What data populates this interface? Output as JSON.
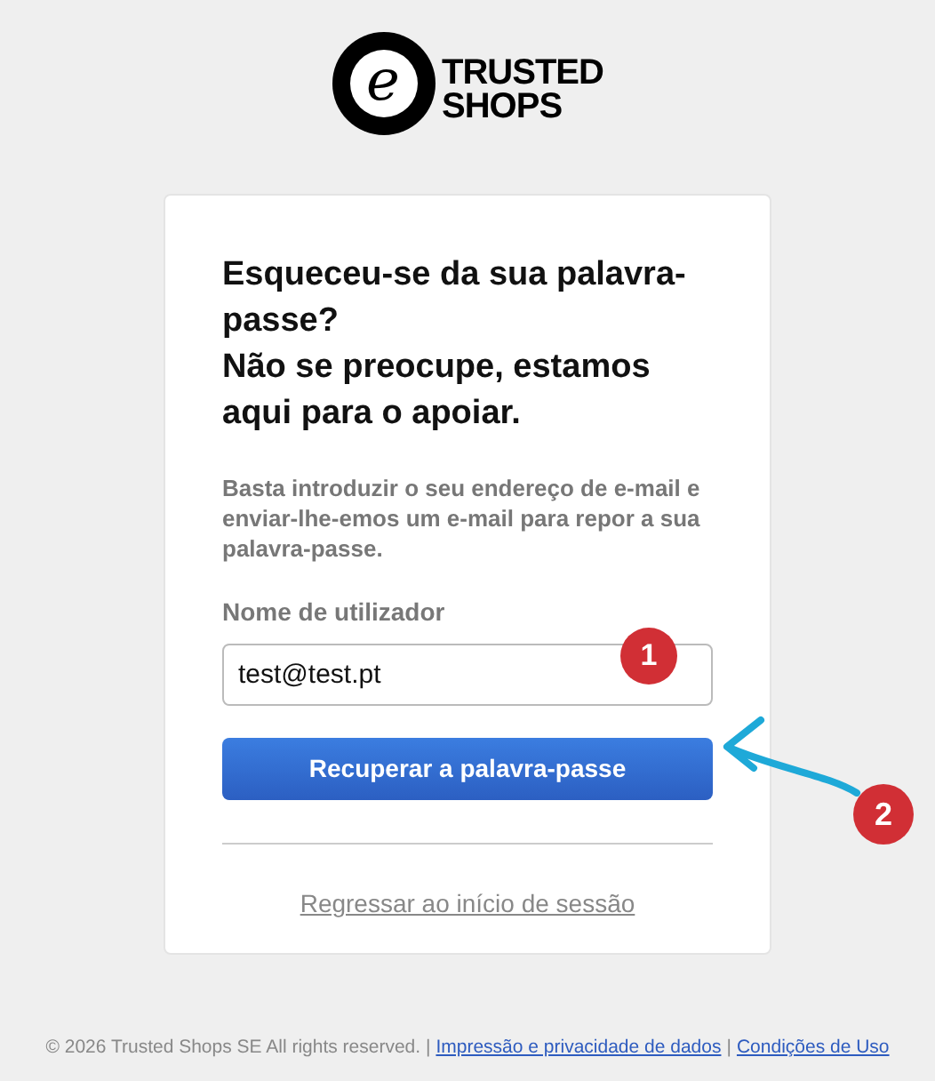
{
  "logo": {
    "mark": "e",
    "name_lines": [
      "TRUSTED",
      "SHOPS"
    ]
  },
  "card": {
    "heading": [
      "Esqueceu-se da sua palavra-passe?",
      "Não se preocupe, estamos aqui para o apoiar."
    ],
    "intro": "Basta introduzir o seu endereço de e-mail e enviar-lhe-emos um e-mail para repor a sua palavra-passe.",
    "field": {
      "label": "Nome de utilizador",
      "value": "test@test.pt"
    },
    "submit": "Recuperar a palavra-passe",
    "back_link": "Regressar ao início de sessão"
  },
  "annotations": [
    {
      "number": "1"
    },
    {
      "number": "2"
    }
  ],
  "footer": {
    "copyright": "© 2026 Trusted Shops SE All rights reserved. |",
    "links": [
      {
        "label": "Impressão e privacidade de dados"
      },
      {
        "label": "Condições de Uso"
      }
    ],
    "separator": "|"
  }
}
